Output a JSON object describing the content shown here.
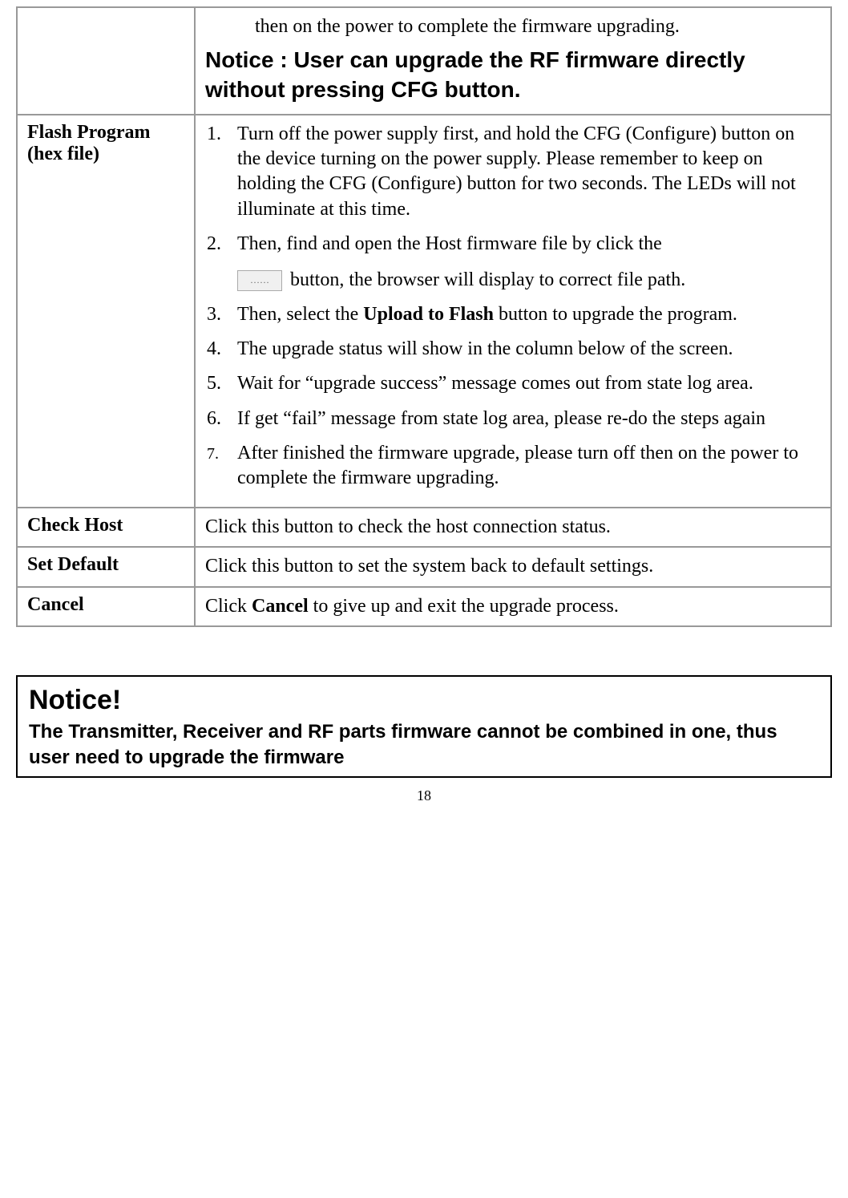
{
  "table": {
    "row1": {
      "partial_step": "then on the power to complete the firmware upgrading.",
      "notice": "Notice :   User can upgrade the RF firmware directly without pressing CFG button."
    },
    "row2": {
      "label": "Flash Program (hex file)",
      "step1": "Turn off the power supply first, and hold the CFG (Configure) button on the device turning on the power supply. Please remember to keep on holding the CFG (Configure) button for two seconds. The LEDs will not illuminate at this time.",
      "step2_a": "Then, find and open the Host firmware file by click the",
      "step2_btn": "……",
      "step2_b": " button, the browser will display to correct file path.",
      "step3_a": "Then, select the ",
      "step3_bold": "Upload to Flash",
      "step3_b": " button to upgrade the program.",
      "step4": "The upgrade status will show in the column below of the screen.",
      "step5": "Wait for “upgrade success” message comes out from state log area.",
      "step6": "If get “fail” message from state log area, please re-do the steps again",
      "step7": "After finished the firmware upgrade, please turn off then on the power to complete the firmware upgrading."
    },
    "row3": {
      "label": "Check Host",
      "desc": "Click this button to check the host connection status."
    },
    "row4": {
      "label": "Set Default",
      "desc": "Click this button to set the system back to default settings."
    },
    "row5": {
      "label": "Cancel",
      "desc_a": "Click ",
      "desc_bold": "Cancel",
      "desc_b": " to give up and exit the upgrade process."
    }
  },
  "notice_box": {
    "title": "Notice!",
    "body": "The Transmitter, Receiver and RF parts firmware cannot be combined in one, thus user need to upgrade the firmware"
  },
  "page_number": "18"
}
